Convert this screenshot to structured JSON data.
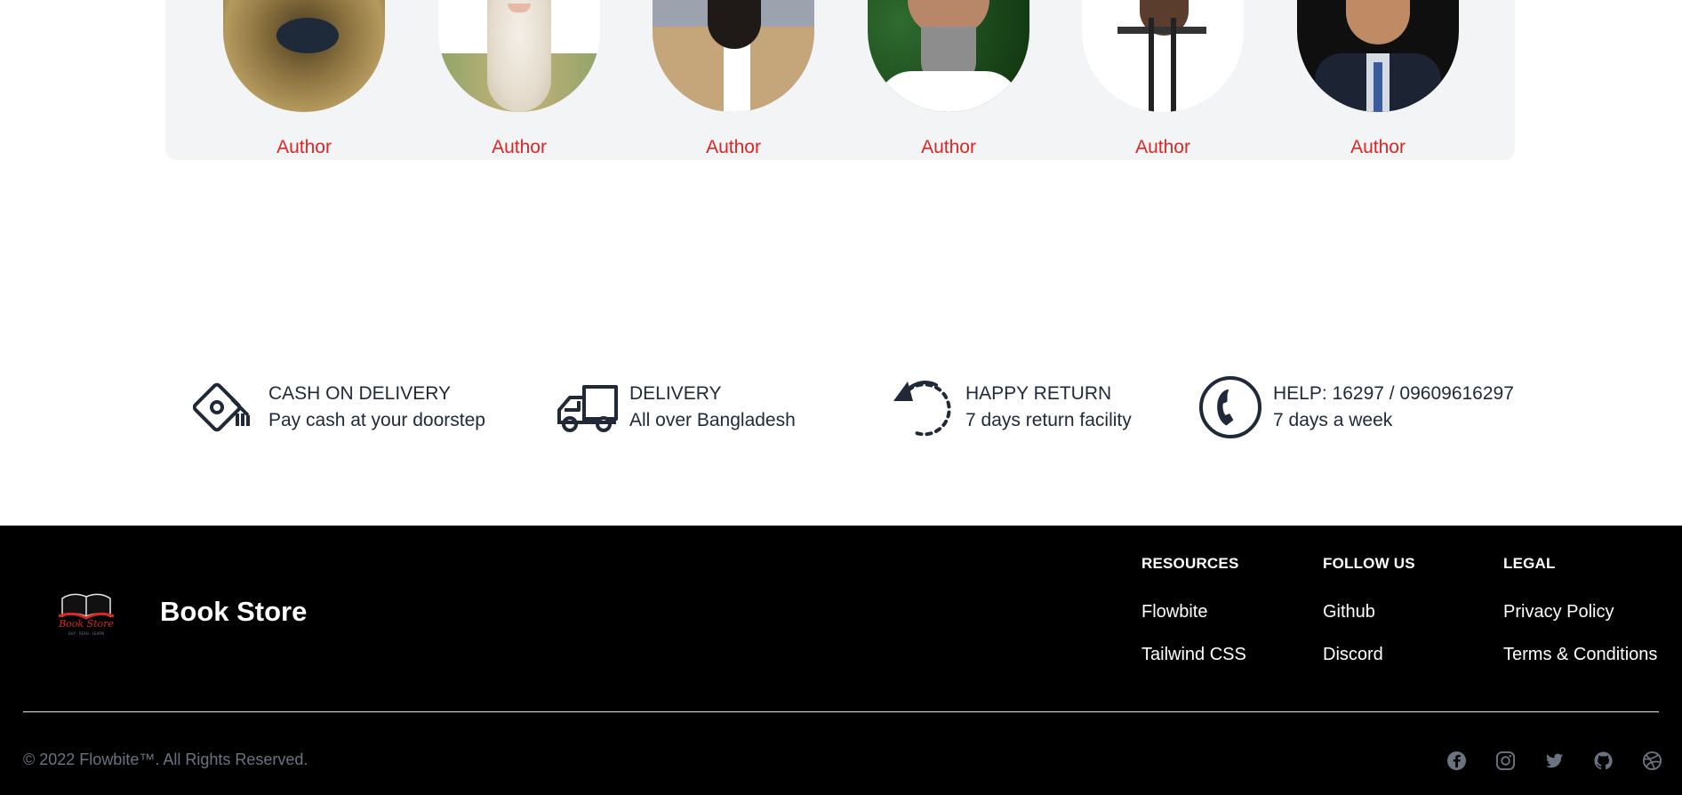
{
  "authors": [
    {
      "name": "Author",
      "photo": "author-photo-1"
    },
    {
      "name": "Author",
      "photo": "author-photo-2"
    },
    {
      "name": "Author",
      "photo": "author-photo-3"
    },
    {
      "name": "Author",
      "photo": "author-photo-4"
    },
    {
      "name": "Author",
      "photo": "author-photo-5"
    },
    {
      "name": "Author",
      "photo": "author-photo-6"
    }
  ],
  "features": [
    {
      "icon": "cash-icon",
      "title": "CASH ON DELIVERY",
      "subtitle": "Pay cash at your doorstep"
    },
    {
      "icon": "truck-icon",
      "title": "DELIVERY",
      "subtitle": "All over Bangladesh"
    },
    {
      "icon": "return-icon",
      "title": "HAPPY RETURN",
      "subtitle": "7 days return facility"
    },
    {
      "icon": "phone-icon",
      "title": "HELP: 16297 / 09609616297",
      "subtitle": "7 days a week"
    }
  ],
  "footer": {
    "brand_name": "Book Store",
    "columns": [
      {
        "heading": "RESOURCES",
        "links": [
          "Flowbite",
          "Tailwind CSS"
        ]
      },
      {
        "heading": "FOLLOW US",
        "links": [
          "Github",
          "Discord"
        ]
      },
      {
        "heading": "LEGAL",
        "links": [
          "Privacy Policy",
          "Terms & Conditions"
        ]
      }
    ],
    "copyright": "© 2022 Flowbite™. All Rights Reserved.",
    "socials": [
      "facebook-icon",
      "instagram-icon",
      "twitter-icon",
      "github-icon",
      "dribbble-icon"
    ]
  },
  "colors": {
    "accent": "#dc2626",
    "panel": "#f3f4f6",
    "footer_bg": "#000000",
    "muted": "#6b7280"
  }
}
